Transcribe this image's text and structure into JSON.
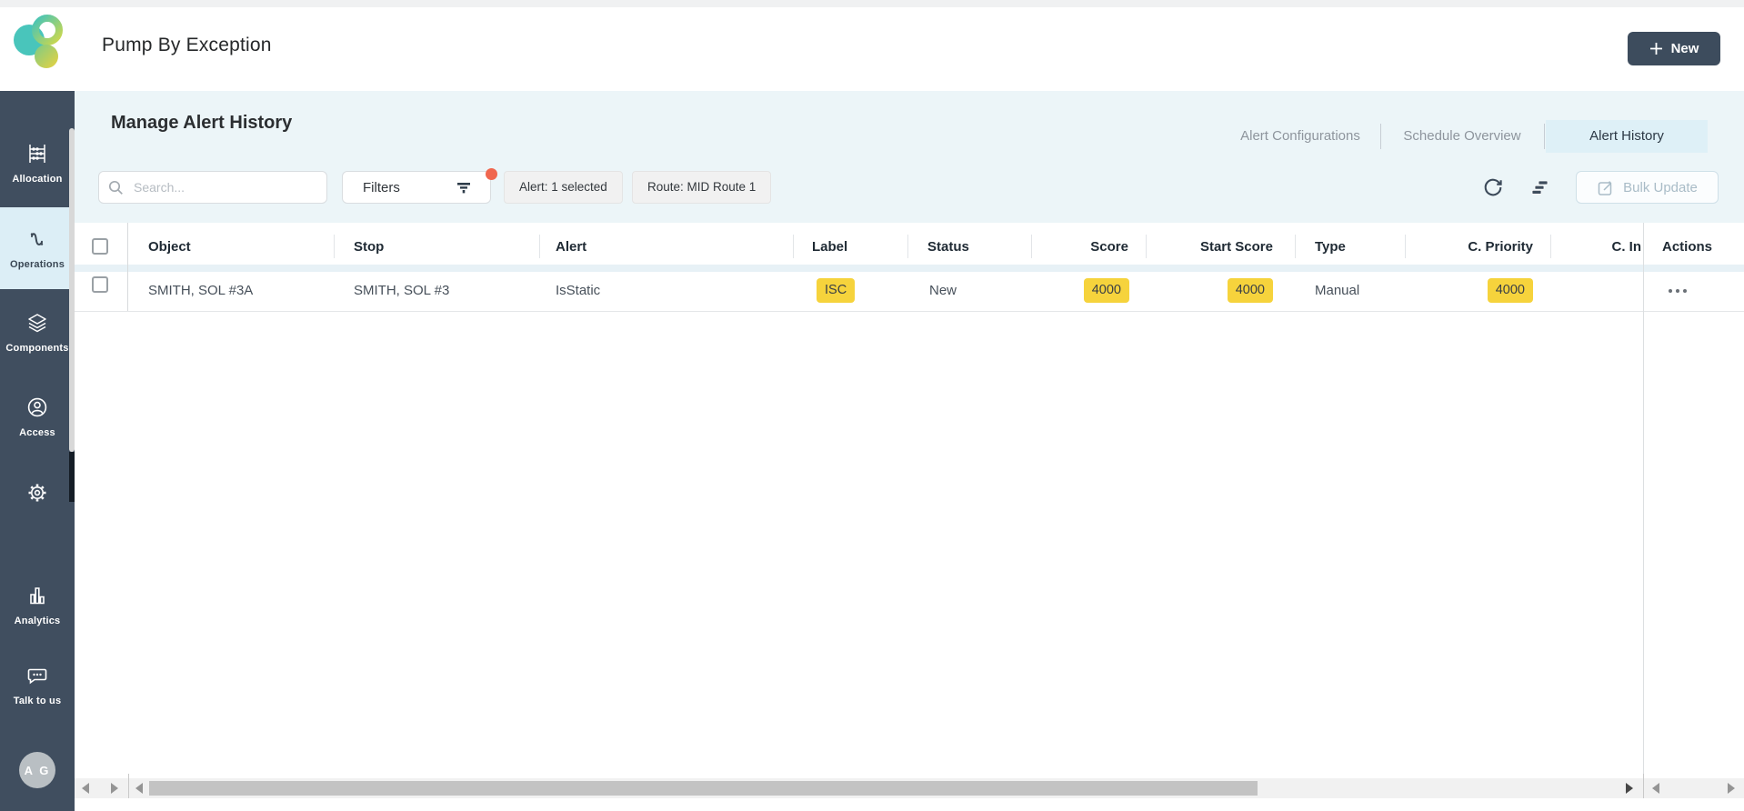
{
  "header": {
    "title": "Pump By Exception",
    "new_button_label": "New"
  },
  "sidebar": {
    "items": [
      {
        "label": "Allocation"
      },
      {
        "label": "Operations"
      },
      {
        "label": "Components"
      },
      {
        "label": "Access"
      },
      {
        "label": "Analytics"
      },
      {
        "label": "Talk to us"
      }
    ],
    "avatar_initials": "A G"
  },
  "page": {
    "heading": "Manage Alert History"
  },
  "tabs": [
    {
      "label": "Alert Configurations",
      "active": false
    },
    {
      "label": "Schedule Overview",
      "active": false
    },
    {
      "label": "Alert History",
      "active": true
    }
  ],
  "toolbar": {
    "search_placeholder": "Search...",
    "filters_label": "Filters",
    "chips": [
      {
        "label": "Alert: 1 selected"
      },
      {
        "label": "Route: MID Route 1"
      }
    ],
    "bulk_update_label": "Bulk Update"
  },
  "table": {
    "columns": [
      {
        "label": "Object",
        "align": "left"
      },
      {
        "label": "Stop",
        "align": "left"
      },
      {
        "label": "Alert",
        "align": "left"
      },
      {
        "label": "Label",
        "align": "left"
      },
      {
        "label": "Status",
        "align": "left"
      },
      {
        "label": "Score",
        "align": "right"
      },
      {
        "label": "Start Score",
        "align": "right"
      },
      {
        "label": "Type",
        "align": "left"
      },
      {
        "label": "C. Priority",
        "align": "right"
      },
      {
        "label": "C. In",
        "align": "right"
      },
      {
        "label": "Actions",
        "align": "left"
      }
    ],
    "rows": [
      {
        "object": "SMITH, SOL #3A",
        "stop": "SMITH, SOL #3",
        "alert": "IsStatic",
        "label_badge": "ISC",
        "status": "New",
        "score_badge": "4000",
        "start_score_badge": "4000",
        "type": "Manual",
        "c_priority_badge": "4000"
      }
    ]
  },
  "colors": {
    "sidebar_bg": "#404e5f",
    "sidebar_active_bg": "#dceef6",
    "content_bg": "#ecf5f8",
    "active_tab_bg": "#def0f7",
    "badge_yellow": "#f6d33c",
    "accent_dark": "#3d4c5d",
    "filter_dot": "#f0674f"
  }
}
